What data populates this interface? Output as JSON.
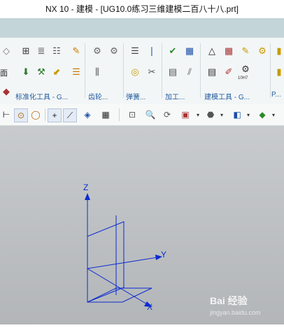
{
  "window": {
    "title": "NX 10 - 建模 - [UG10.0练习三维建模二百八十八.prt]"
  },
  "ribbon": {
    "side_label": "面",
    "groups": [
      {
        "label": "标准化工具 - G..."
      },
      {
        "label": "齿轮..."
      },
      {
        "label": "弹簧..."
      },
      {
        "label": "加工..."
      },
      {
        "label": "建模工具 - G..."
      },
      {
        "label": "P..."
      }
    ],
    "gear_badge_text": "10H7"
  },
  "axes": {
    "z_label": "Z",
    "y_label": "Y",
    "x_label": "X"
  },
  "watermark": {
    "brand": "Bai 经验",
    "url": "jingyan.baidu.com"
  },
  "colors": {
    "axis_blue": "#0b2bd1",
    "canvas_top": "#c8cbcd",
    "canvas_bottom": "#b3b6b8"
  }
}
